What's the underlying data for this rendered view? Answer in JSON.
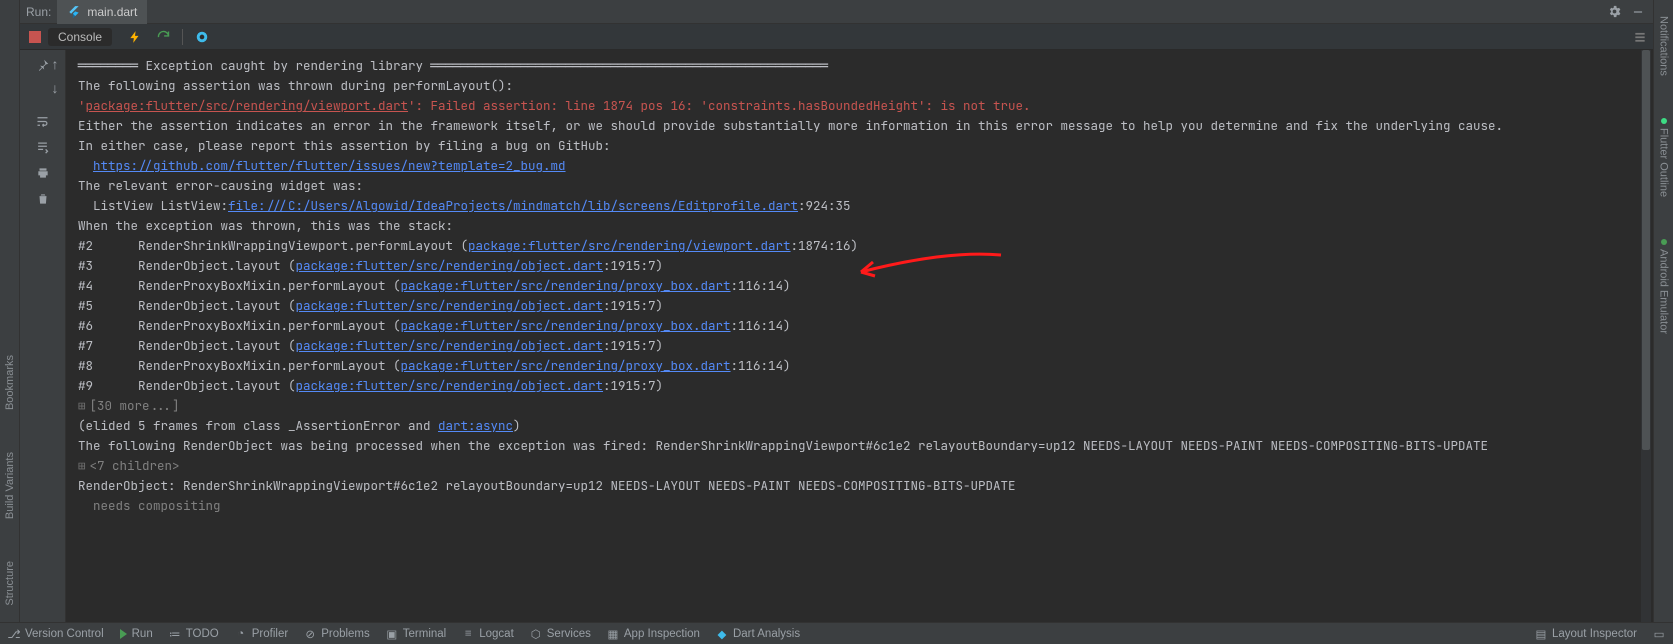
{
  "topbar": {
    "run_label": "Run:",
    "tab_label": "main.dart"
  },
  "toolbar": {
    "console_label": "Console"
  },
  "rails": {
    "left": [
      "Bookmarks",
      "Build Variants",
      "Structure"
    ],
    "right": [
      "Notifications",
      "Flutter Outline",
      "Android Emulator"
    ]
  },
  "console": {
    "l0": "════════ Exception caught by rendering library ═════════════════════════════════════════════════════",
    "l1": "The following assertion was thrown during performLayout():",
    "l2a": "'",
    "l2link": "package:flutter/src/rendering/viewport.dart",
    "l2b": "': Failed assertion: line 1874 pos 16: 'constraints.hasBoundedHeight': is not true.",
    "l3": "",
    "l4": "",
    "l5": "Either the assertion indicates an error in the framework itself, or we should provide substantially more information in this error message to help you determine and fix the underlying cause.",
    "l6": "In either case, please report this assertion by filing a bug on GitHub:",
    "l7pad": "  ",
    "l7link": "https://github.com/flutter/flutter/issues/new?template=2_bug.md",
    "l8": "",
    "l9": "The relevant error-causing widget was: ",
    "l10a": "  ListView ListView:",
    "l10link": "file:///C:/Users/Algowid/IdeaProjects/mindmatch/lib/screens/Editprofile.dart",
    "l10b": ":924:35",
    "l11": "When the exception was thrown, this was the stack: ",
    "stk": [
      {
        "pre": "#2      RenderShrinkWrappingViewport.performLayout (",
        "link": "package:flutter/src/rendering/viewport.dart",
        "post": ":1874:16)"
      },
      {
        "pre": "#3      RenderObject.layout (",
        "link": "package:flutter/src/rendering/object.dart",
        "post": ":1915:7)"
      },
      {
        "pre": "#4      RenderProxyBoxMixin.performLayout (",
        "link": "package:flutter/src/rendering/proxy_box.dart",
        "post": ":116:14)"
      },
      {
        "pre": "#5      RenderObject.layout (",
        "link": "package:flutter/src/rendering/object.dart",
        "post": ":1915:7)"
      },
      {
        "pre": "#6      RenderProxyBoxMixin.performLayout (",
        "link": "package:flutter/src/rendering/proxy_box.dart",
        "post": ":116:14)"
      },
      {
        "pre": "#7      RenderObject.layout (",
        "link": "package:flutter/src/rendering/object.dart",
        "post": ":1915:7)"
      },
      {
        "pre": "#8      RenderProxyBoxMixin.performLayout (",
        "link": "package:flutter/src/rendering/proxy_box.dart",
        "post": ":116:14)"
      },
      {
        "pre": "#9      RenderObject.layout (",
        "link": "package:flutter/src/rendering/object.dart",
        "post": ":1915:7)"
      }
    ],
    "l20": "[30 more...]",
    "l21a": "(elided 5 frames from class _AssertionError and ",
    "l21link": "dart:async",
    "l21b": ")",
    "l22": "The following RenderObject was being processed when the exception was fired: RenderShrinkWrappingViewport#6c1e2 relayoutBoundary=up12 NEEDS-LAYOUT NEEDS-PAINT NEEDS-COMPOSITING-BITS-UPDATE",
    "l23": "<7 children>",
    "l24": "RenderObject: RenderShrinkWrappingViewport#6c1e2 relayoutBoundary=up12 NEEDS-LAYOUT NEEDS-PAINT NEEDS-COMPOSITING-BITS-UPDATE",
    "l25": "  needs compositing"
  },
  "status": {
    "items_left": [
      "Version Control",
      "Run",
      "TODO",
      "Profiler",
      "Problems",
      "Terminal",
      "Logcat",
      "Services",
      "App Inspection",
      "Dart Analysis"
    ],
    "items_right": [
      "Layout Inspector"
    ]
  }
}
